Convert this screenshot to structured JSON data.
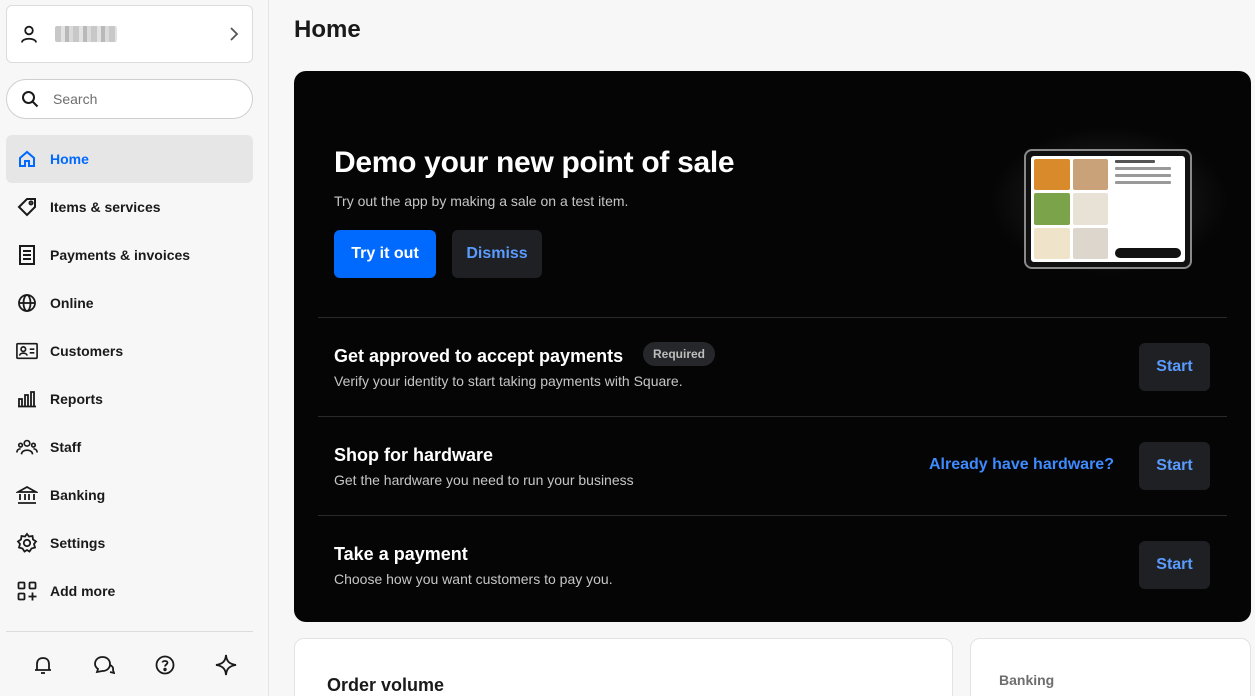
{
  "sidebar": {
    "account_chevron_icon": "chevron-right-icon",
    "search": {
      "placeholder": "Search"
    },
    "items": [
      {
        "label": "Home",
        "icon": "home-icon",
        "active": true
      },
      {
        "label": "Items & services",
        "icon": "tag-icon"
      },
      {
        "label": "Payments & invoices",
        "icon": "receipt-icon"
      },
      {
        "label": "Online",
        "icon": "globe-icon"
      },
      {
        "label": "Customers",
        "icon": "contact-card-icon"
      },
      {
        "label": "Reports",
        "icon": "bar-chart-icon"
      },
      {
        "label": "Staff",
        "icon": "people-icon"
      },
      {
        "label": "Banking",
        "icon": "bank-icon"
      },
      {
        "label": "Settings",
        "icon": "gear-icon"
      },
      {
        "label": "Add more",
        "icon": "add-apps-icon"
      }
    ],
    "bottom_icons": [
      "bell-icon",
      "chat-icon",
      "help-icon",
      "sparkle-icon"
    ]
  },
  "main": {
    "title": "Home",
    "hero": {
      "title": "Demo your new point of sale",
      "subtitle": "Try out the app by making a sale on a test item.",
      "primary_label": "Try it out",
      "dismiss_label": "Dismiss"
    },
    "tasks": [
      {
        "title": "Get approved to accept payments",
        "badge": "Required",
        "subtitle": "Verify your identity to start taking payments with Square.",
        "button": "Start"
      },
      {
        "title": "Shop for hardware",
        "subtitle": "Get the hardware you need to run your business",
        "link": "Already have hardware?",
        "button": "Start"
      },
      {
        "title": "Take a payment",
        "subtitle": "Choose how you want customers to pay you.",
        "button": "Start"
      }
    ],
    "order_volume_title": "Order volume",
    "banking_title": "Banking"
  },
  "colors": {
    "accent": "#006aff",
    "link": "#3d8bff",
    "dark_card": "#050505",
    "secondary_button": "#1f2023"
  }
}
